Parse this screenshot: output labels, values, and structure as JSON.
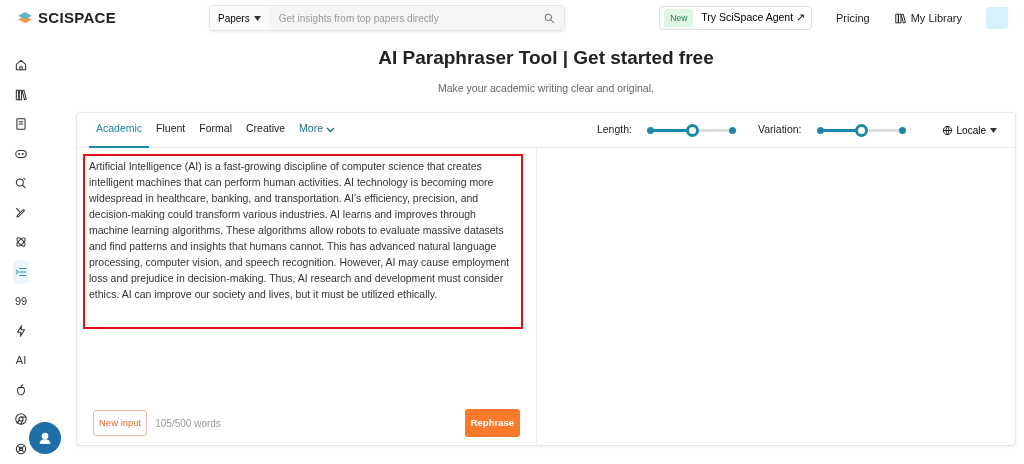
{
  "header": {
    "brand": "SCISPACE",
    "search": {
      "scope": "Papers",
      "placeholder": "Get insights from top papers directly"
    },
    "agent": {
      "badge": "New",
      "label": "Try SciSpace Agent",
      "arrow": "↗"
    },
    "links": [
      {
        "kind": "text",
        "label": "Pricing"
      },
      {
        "kind": "library",
        "label": "My Library"
      }
    ]
  },
  "sidebar": {
    "items": [
      {
        "kind": "home",
        "selected": false
      },
      {
        "kind": "books",
        "selected": false
      },
      {
        "kind": "notebook",
        "selected": false
      },
      {
        "kind": "chat",
        "selected": false
      },
      {
        "kind": "search",
        "selected": false
      },
      {
        "kind": "pen",
        "selected": false
      },
      {
        "kind": "atom",
        "selected": false
      },
      {
        "kind": "list",
        "selected": true
      },
      {
        "kind": "text",
        "label": "99",
        "selected": false
      },
      {
        "kind": "bolt",
        "selected": false
      },
      {
        "kind": "text",
        "label": "AI",
        "selected": false
      },
      {
        "kind": "apple",
        "selected": false
      },
      {
        "kind": "chrome",
        "selected": false
      },
      {
        "kind": "knot",
        "selected": false
      }
    ]
  },
  "page": {
    "title": "AI Paraphraser Tool | Get started free",
    "subtitle": "Make your academic writing clear and original."
  },
  "tool": {
    "tabs": [
      {
        "label": "Academic",
        "selected": true
      },
      {
        "label": "Fluent",
        "selected": false
      },
      {
        "label": "Formal",
        "selected": false
      },
      {
        "label": "Creative",
        "selected": false
      },
      {
        "label": "More",
        "selected": false,
        "kind": "dropdown"
      }
    ],
    "sliders": [
      {
        "label": "Length:",
        "level": 0.51
      },
      {
        "label": "Variation:",
        "level": 0.5
      }
    ],
    "locale": "Locale",
    "input": {
      "highlighted": true,
      "text": "Artificial Intelligence (AI) is a fast-growing discipline of computer science that creates intelligent machines that can perform human activities. AI technology is becoming more widespread in healthcare, banking, and transportation. AI's efficiency, precision, and decision-making could transform various industries. AI learns and improves through machine learning algorithms. These algorithms allow robots to evaluate massive datasets and find patterns and insights that humans cannot. This has advanced natural language processing, computer vision, and speech recognition. However, AI may cause employment loss and prejudice in decision-making. Thus, AI research and development must consider ethics. AI can improve our society and lives, but it must be utilized ethically."
    },
    "new_input": "New input",
    "word_count": "105/500 words",
    "rephrase": "Rephrase"
  }
}
